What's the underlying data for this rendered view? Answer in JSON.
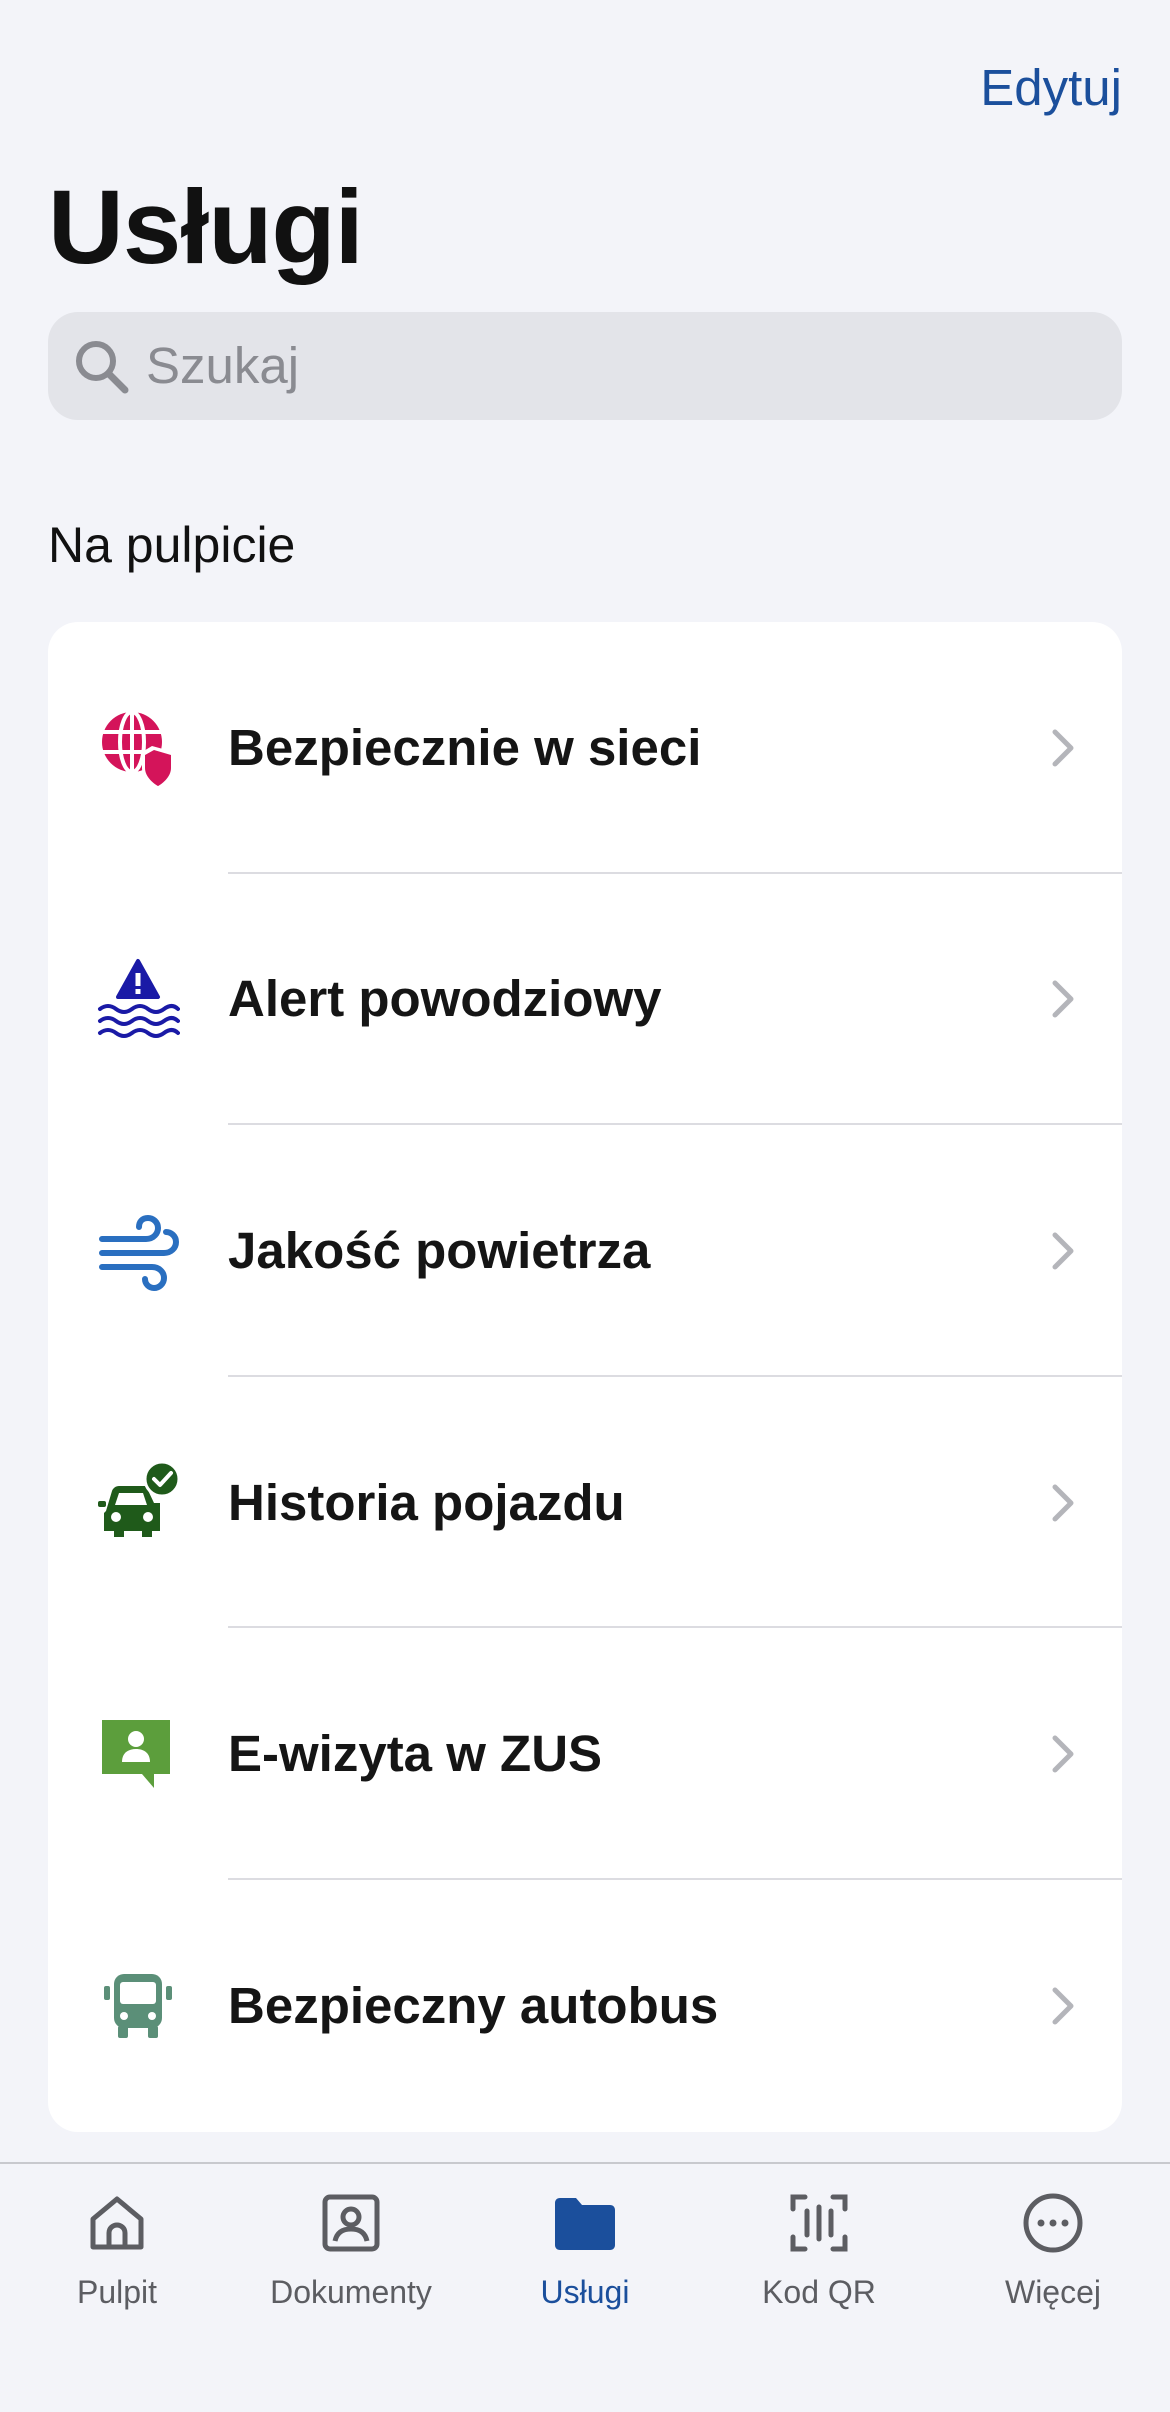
{
  "header": {
    "edit_label": "Edytuj",
    "title": "Usługi"
  },
  "search": {
    "placeholder": "Szukaj"
  },
  "section": {
    "title": "Na pulpicie",
    "items": [
      {
        "label": "Bezpiecznie w sieci",
        "icon": "globe-shield-icon",
        "color": "#d4145a"
      },
      {
        "label": "Alert powodziowy",
        "icon": "flood-alert-icon",
        "color": "#1a1aa6"
      },
      {
        "label": "Jakość powietrza",
        "icon": "wind-icon",
        "color": "#2a6fc0"
      },
      {
        "label": "Historia pojazdu",
        "icon": "car-check-icon",
        "color": "#1f5a1a"
      },
      {
        "label": "E-wizyta w ZUS",
        "icon": "person-chat-icon",
        "color": "#5c9e3c"
      },
      {
        "label": "Bezpieczny autobus",
        "icon": "bus-icon",
        "color": "#5b8f78"
      }
    ]
  },
  "tab_bar": {
    "tabs": [
      {
        "label": "Pulpit",
        "icon": "home-icon",
        "active": false
      },
      {
        "label": "Dokumenty",
        "icon": "id-card-icon",
        "active": false
      },
      {
        "label": "Usługi",
        "icon": "folder-icon",
        "active": true
      },
      {
        "label": "Kod QR",
        "icon": "qr-scan-icon",
        "active": false
      },
      {
        "label": "Więcej",
        "icon": "more-icon",
        "active": false
      }
    ]
  },
  "colors": {
    "accent": "#1b4f9c",
    "background": "#f3f4f9",
    "card": "#ffffff"
  }
}
